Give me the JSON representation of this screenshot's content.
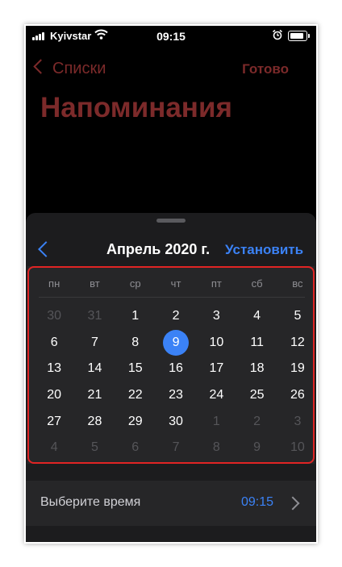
{
  "status_bar": {
    "carrier": "Kyivstar",
    "time": "09:15"
  },
  "nav": {
    "back_label": "Списки",
    "done_label": "Готово",
    "title": "Напоминания"
  },
  "calendar": {
    "month_title": "Апрель 2020 г.",
    "set_label": "Установить",
    "weekdays": [
      "пн",
      "вт",
      "ср",
      "чт",
      "пт",
      "сб",
      "вс"
    ],
    "days": [
      {
        "label": "30",
        "muted": true
      },
      {
        "label": "31",
        "muted": true
      },
      {
        "label": "1"
      },
      {
        "label": "2"
      },
      {
        "label": "3"
      },
      {
        "label": "4"
      },
      {
        "label": "5"
      },
      {
        "label": "6"
      },
      {
        "label": "7"
      },
      {
        "label": "8"
      },
      {
        "label": "9",
        "selected": true
      },
      {
        "label": "10"
      },
      {
        "label": "11"
      },
      {
        "label": "12"
      },
      {
        "label": "13"
      },
      {
        "label": "14"
      },
      {
        "label": "15"
      },
      {
        "label": "16"
      },
      {
        "label": "17"
      },
      {
        "label": "18"
      },
      {
        "label": "19"
      },
      {
        "label": "20"
      },
      {
        "label": "21"
      },
      {
        "label": "22"
      },
      {
        "label": "23"
      },
      {
        "label": "24"
      },
      {
        "label": "25"
      },
      {
        "label": "26"
      },
      {
        "label": "27"
      },
      {
        "label": "28"
      },
      {
        "label": "29"
      },
      {
        "label": "30"
      },
      {
        "label": "1",
        "muted": true
      },
      {
        "label": "2",
        "muted": true
      },
      {
        "label": "3",
        "muted": true
      },
      {
        "label": "4",
        "muted": true
      },
      {
        "label": "5",
        "muted": true
      },
      {
        "label": "6",
        "muted": true
      },
      {
        "label": "7",
        "muted": true
      },
      {
        "label": "8",
        "muted": true
      },
      {
        "label": "9",
        "muted": true
      },
      {
        "label": "10",
        "muted": true
      }
    ]
  },
  "time_picker": {
    "label": "Выберите время",
    "value": "09:15"
  },
  "colors": {
    "accent": "#3b82f6",
    "highlight_outline": "#e02424",
    "dimmed_red": "#7c2a2a"
  }
}
